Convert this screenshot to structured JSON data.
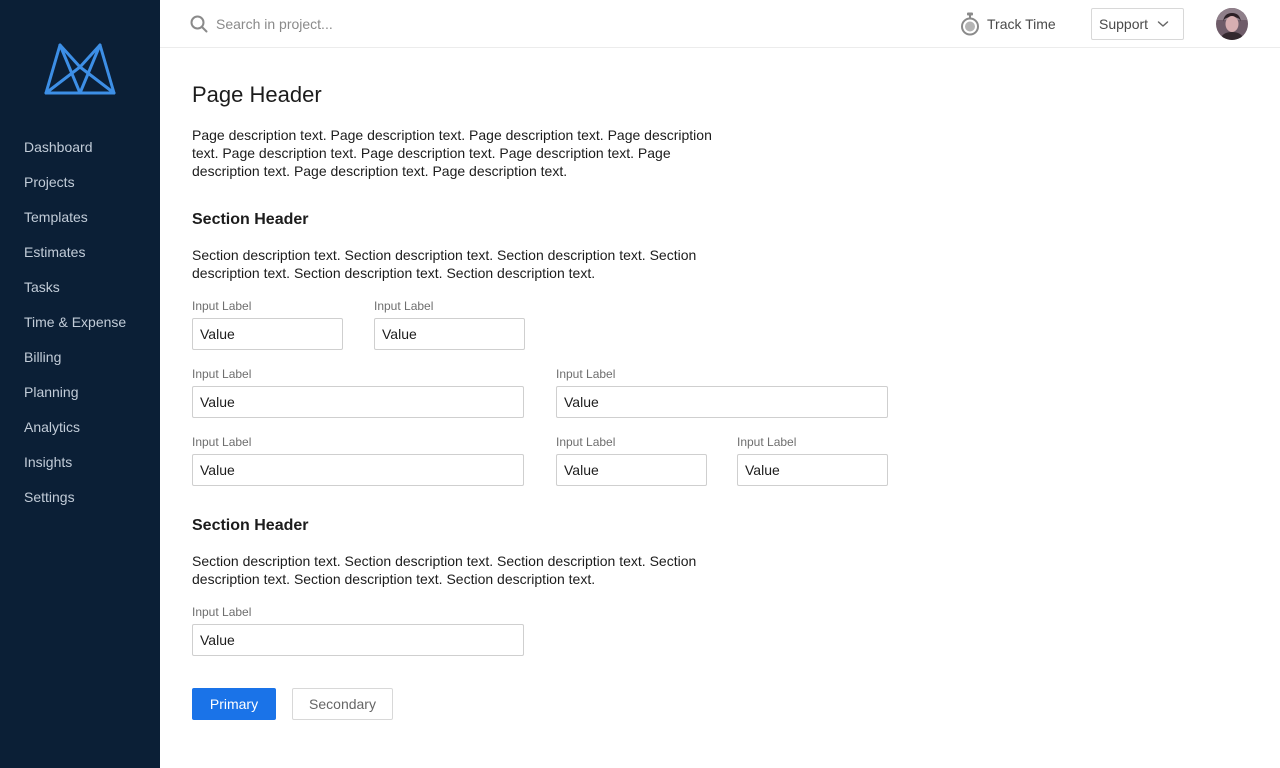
{
  "sidebar": {
    "logo_icon": "m-logo-icon",
    "items": [
      {
        "label": "Dashboard"
      },
      {
        "label": "Projects"
      },
      {
        "label": "Templates"
      },
      {
        "label": "Estimates"
      },
      {
        "label": "Tasks"
      },
      {
        "label": "Time & Expense"
      },
      {
        "label": "Billing"
      },
      {
        "label": "Planning"
      },
      {
        "label": "Analytics"
      },
      {
        "label": "Insights"
      },
      {
        "label": "Settings"
      }
    ]
  },
  "topbar": {
    "search": {
      "placeholder": "Search in project...",
      "value": "",
      "icon": "search-icon"
    },
    "track_time": {
      "label": "Track Time",
      "icon": "stopwatch-icon"
    },
    "support": {
      "label": "Support",
      "icon": "chevron-down-icon"
    },
    "avatar": {
      "icon": "avatar"
    }
  },
  "page": {
    "title": "Page Header",
    "description": "Page description text. Page description text. Page description text. Page description text. Page description text. Page description text. Page description text. Page description text. Page description text. Page description text."
  },
  "sections": [
    {
      "title": "Section Header",
      "description": "Section description text. Section description text. Section description text. Section description text. Section description text. Section description text.",
      "fields": [
        {
          "label": "Input Label",
          "value": "Value"
        },
        {
          "label": "Input Label",
          "value": "Value"
        },
        {
          "label": "Input Label",
          "value": "Value"
        },
        {
          "label": "Input Label",
          "value": "Value"
        },
        {
          "label": "Input Label",
          "value": "Value"
        },
        {
          "label": "Input Label",
          "value": "Value"
        },
        {
          "label": "Input Label",
          "value": "Value"
        }
      ]
    },
    {
      "title": "Section Header",
      "description": "Section description text. Section description text. Section description text. Section description text. Section description text. Section description text.",
      "fields": [
        {
          "label": "Input Label",
          "value": "Value"
        }
      ]
    }
  ],
  "actions": {
    "primary_label": "Primary",
    "secondary_label": "Secondary"
  },
  "colors": {
    "sidebar_bg": "#0b1f36",
    "accent": "#1a73e8",
    "logo": "#3d8fe6",
    "nav_text": "#c2ccd8"
  }
}
